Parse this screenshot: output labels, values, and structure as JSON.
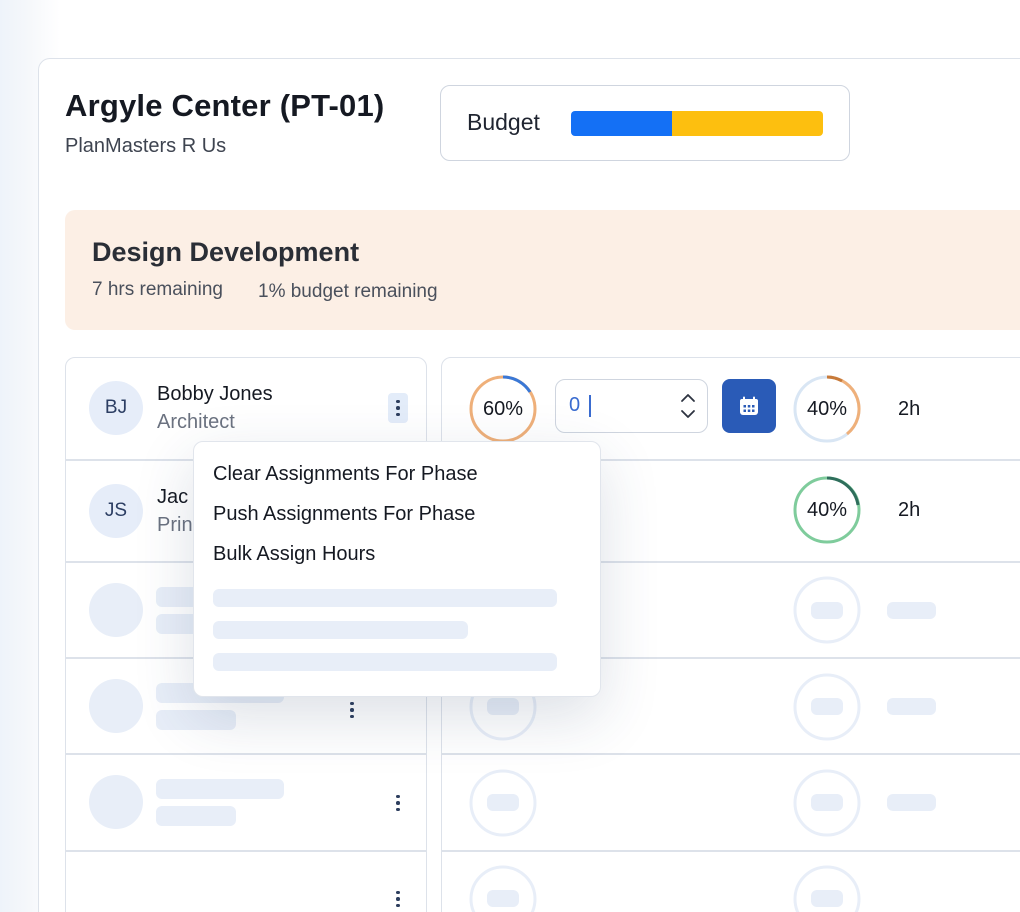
{
  "project": {
    "title": "Argyle Center (PT-01)",
    "client": "PlanMasters R Us"
  },
  "budget": {
    "label": "Budget",
    "used_fraction": 0.4,
    "colors": {
      "used": "#1470f5",
      "remaining": "#fdbf0f"
    }
  },
  "phase": {
    "title": "Design Development",
    "hours_remaining": "7 hrs remaining",
    "budget_remaining": "1% budget remaining",
    "background": "#fcefe5"
  },
  "people": [
    {
      "initials": "BJ",
      "name": "Bobby Jones",
      "role": "Architect"
    },
    {
      "initials": "JS",
      "name": "Jac",
      "role": "Prin"
    }
  ],
  "allocations": [
    {
      "left_percent": "60%",
      "left_fraction": 0.6,
      "input_value": "0",
      "calendar_icon": "calendar-icon",
      "right_percent": "40%",
      "right_fraction": 0.4,
      "hours": "2h"
    },
    {
      "right_percent": "40%",
      "right_fraction": 0.9,
      "hours": "2h"
    }
  ],
  "menu": {
    "items": [
      "Clear Assignments For Phase",
      "Push Assignments For Phase",
      "Bulk Assign Hours"
    ]
  },
  "icons": {
    "kebab": "more-vertical-icon",
    "stepper": "chevron-up-down-icon",
    "calendar": "calendar-icon"
  },
  "colors": {
    "accent": "#2a5bb7",
    "ring_blue": "#3a78d6",
    "ring_orange": "#efb07a",
    "ring_green": "#7fcc9c",
    "ring_dark_green": "#2f6e5c",
    "ring_track": "#d9e6f4"
  }
}
